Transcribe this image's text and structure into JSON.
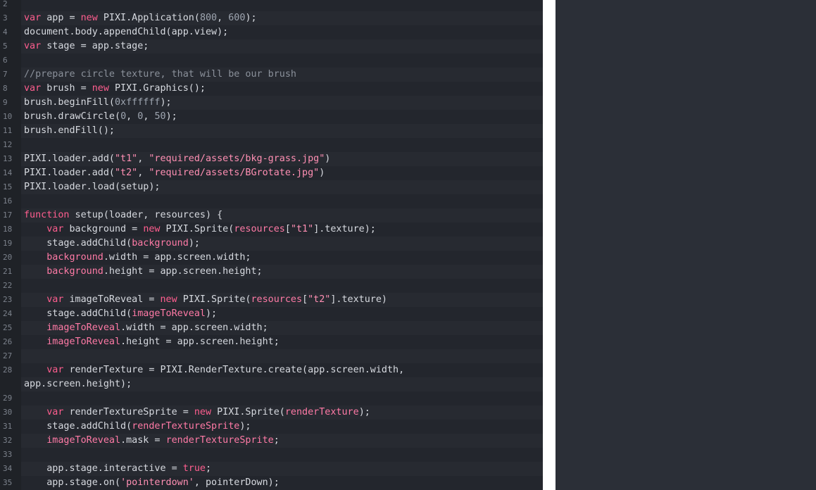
{
  "editor": {
    "lines": [
      {
        "n": "2",
        "tokens": []
      },
      {
        "n": "3",
        "tokens": [
          [
            "kw",
            "var"
          ],
          [
            "t",
            " app = "
          ],
          [
            "kw",
            "new"
          ],
          [
            "t",
            " PIXI.Application("
          ],
          [
            "num",
            "800"
          ],
          [
            "t",
            ", "
          ],
          [
            "num",
            "600"
          ],
          [
            "t",
            ");"
          ]
        ]
      },
      {
        "n": "4",
        "tokens": [
          [
            "t",
            "document.body.appendChild(app.view);"
          ]
        ]
      },
      {
        "n": "5",
        "tokens": [
          [
            "kw",
            "var"
          ],
          [
            "t",
            " stage = app.stage;"
          ]
        ]
      },
      {
        "n": "6",
        "tokens": []
      },
      {
        "n": "7",
        "tokens": [
          [
            "cmt",
            "//prepare circle texture, that will be our brush"
          ]
        ]
      },
      {
        "n": "8",
        "tokens": [
          [
            "kw",
            "var"
          ],
          [
            "t",
            " brush = "
          ],
          [
            "kw",
            "new"
          ],
          [
            "t",
            " PIXI.Graphics();"
          ]
        ]
      },
      {
        "n": "9",
        "tokens": [
          [
            "t",
            "brush.beginFill("
          ],
          [
            "num",
            "0xffffff"
          ],
          [
            "t",
            ");"
          ]
        ]
      },
      {
        "n": "10",
        "tokens": [
          [
            "t",
            "brush.drawCircle("
          ],
          [
            "num",
            "0"
          ],
          [
            "t",
            ", "
          ],
          [
            "num",
            "0"
          ],
          [
            "t",
            ", "
          ],
          [
            "num",
            "50"
          ],
          [
            "t",
            ");"
          ]
        ]
      },
      {
        "n": "11",
        "tokens": [
          [
            "t",
            "brush.endFill();"
          ]
        ]
      },
      {
        "n": "12",
        "tokens": []
      },
      {
        "n": "13",
        "tokens": [
          [
            "t",
            "PIXI.loader.add("
          ],
          [
            "str",
            "\"t1\""
          ],
          [
            "t",
            ", "
          ],
          [
            "str",
            "\"required/assets/bkg-grass.jpg\""
          ],
          [
            "t",
            ")"
          ]
        ]
      },
      {
        "n": "14",
        "tokens": [
          [
            "t",
            "PIXI.loader.add("
          ],
          [
            "str",
            "\"t2\""
          ],
          [
            "t",
            ", "
          ],
          [
            "str",
            "\"required/assets/BGrotate.jpg\""
          ],
          [
            "t",
            ")"
          ]
        ]
      },
      {
        "n": "15",
        "tokens": [
          [
            "t",
            "PIXI.loader.load(setup);"
          ]
        ]
      },
      {
        "n": "16",
        "tokens": []
      },
      {
        "n": "17",
        "tokens": [
          [
            "kw",
            "function"
          ],
          [
            "t",
            " setup(loader, resources) {"
          ]
        ]
      },
      {
        "n": "18",
        "tokens": [
          [
            "t",
            "    "
          ],
          [
            "kw",
            "var"
          ],
          [
            "t",
            " background = "
          ],
          [
            "kw",
            "new"
          ],
          [
            "t",
            " PIXI.Sprite("
          ],
          [
            "var",
            "resources"
          ],
          [
            "t",
            "["
          ],
          [
            "str",
            "\"t1\""
          ],
          [
            "t",
            "].texture);"
          ]
        ]
      },
      {
        "n": "19",
        "tokens": [
          [
            "t",
            "    stage.addChild("
          ],
          [
            "var",
            "background"
          ],
          [
            "t",
            ");"
          ]
        ]
      },
      {
        "n": "20",
        "tokens": [
          [
            "t",
            "    "
          ],
          [
            "var",
            "background"
          ],
          [
            "t",
            ".width = app.screen.width;"
          ]
        ]
      },
      {
        "n": "21",
        "tokens": [
          [
            "t",
            "    "
          ],
          [
            "var",
            "background"
          ],
          [
            "t",
            ".height = app.screen.height;"
          ]
        ]
      },
      {
        "n": "22",
        "tokens": []
      },
      {
        "n": "23",
        "tokens": [
          [
            "t",
            "    "
          ],
          [
            "kw",
            "var"
          ],
          [
            "t",
            " imageToReveal = "
          ],
          [
            "kw",
            "new"
          ],
          [
            "t",
            " PIXI.Sprite("
          ],
          [
            "var",
            "resources"
          ],
          [
            "t",
            "["
          ],
          [
            "str",
            "\"t2\""
          ],
          [
            "t",
            "].texture)"
          ]
        ]
      },
      {
        "n": "24",
        "tokens": [
          [
            "t",
            "    stage.addChild("
          ],
          [
            "var",
            "imageToReveal"
          ],
          [
            "t",
            ");"
          ]
        ]
      },
      {
        "n": "25",
        "tokens": [
          [
            "t",
            "    "
          ],
          [
            "var",
            "imageToReveal"
          ],
          [
            "t",
            ".width = app.screen.width;"
          ]
        ]
      },
      {
        "n": "26",
        "tokens": [
          [
            "t",
            "    "
          ],
          [
            "var",
            "imageToReveal"
          ],
          [
            "t",
            ".height = app.screen.height;"
          ]
        ]
      },
      {
        "n": "27",
        "tokens": []
      },
      {
        "n": "28",
        "tokens": [
          [
            "t",
            "    "
          ],
          [
            "kw",
            "var"
          ],
          [
            "t",
            " renderTexture = PIXI.RenderTexture.create(app.screen.width,"
          ]
        ]
      },
      {
        "n": "",
        "tokens": [
          [
            "t",
            "app.screen.height);"
          ]
        ]
      },
      {
        "n": "29",
        "tokens": []
      },
      {
        "n": "30",
        "tokens": [
          [
            "t",
            "    "
          ],
          [
            "kw",
            "var"
          ],
          [
            "t",
            " renderTextureSprite = "
          ],
          [
            "kw",
            "new"
          ],
          [
            "t",
            " PIXI.Sprite("
          ],
          [
            "var",
            "renderTexture"
          ],
          [
            "t",
            ");"
          ]
        ]
      },
      {
        "n": "31",
        "tokens": [
          [
            "t",
            "    stage.addChild("
          ],
          [
            "var",
            "renderTextureSprite"
          ],
          [
            "t",
            ");"
          ]
        ]
      },
      {
        "n": "32",
        "tokens": [
          [
            "t",
            "    "
          ],
          [
            "var",
            "imageToReveal"
          ],
          [
            "t",
            ".mask = "
          ],
          [
            "var",
            "renderTextureSprite"
          ],
          [
            "t",
            ";"
          ]
        ]
      },
      {
        "n": "33",
        "tokens": []
      },
      {
        "n": "34",
        "tokens": [
          [
            "t",
            "    app.stage.interactive = "
          ],
          [
            "kw",
            "true"
          ],
          [
            "t",
            ";"
          ]
        ]
      },
      {
        "n": "35",
        "tokens": [
          [
            "t",
            "    app.stage.on("
          ],
          [
            "str",
            "'pointerdown'"
          ],
          [
            "t",
            ", pointerDown);"
          ]
        ]
      }
    ]
  },
  "colors": {
    "editor_bg": "#23262d",
    "keyword": "#ff5e8f",
    "string": "#ff8fb3",
    "number": "#9ea5b0",
    "comment": "#8b919b",
    "variable": "#ff7aa6",
    "text": "#d7dae0"
  }
}
